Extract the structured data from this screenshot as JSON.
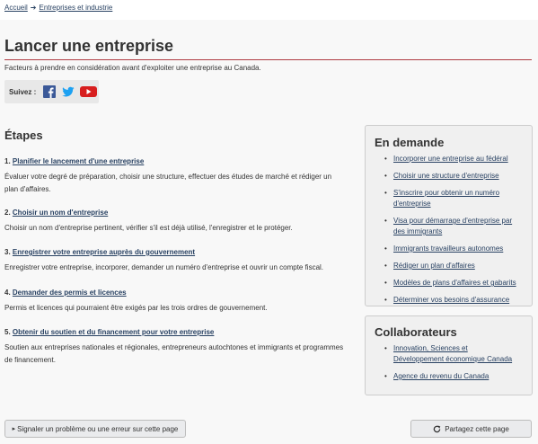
{
  "breadcrumb": {
    "home": "Accueil",
    "arrow": "➔",
    "current": "Entreprises et industrie"
  },
  "page": {
    "title": "Lancer une entreprise",
    "intro": "Facteurs à prendre en considération avant d'exploiter une entreprise au Canada."
  },
  "follow": {
    "label": "Suivez :",
    "icons": [
      "facebook-icon",
      "twitter-icon",
      "youtube-icon"
    ]
  },
  "steps": {
    "heading": "Étapes",
    "items": [
      {
        "num": "1.",
        "link": "Planifier le lancement d'une entreprise",
        "desc": "Évaluer votre degré de préparation, choisir une structure, effectuer des études de marché et rédiger un plan d'affaires."
      },
      {
        "num": "2.",
        "link": "Choisir un nom d'entreprise",
        "desc": "Choisir un nom d'entreprise pertinent, vérifier s'il est déjà utilisé, l'enregistrer et le protéger."
      },
      {
        "num": "3.",
        "link": "Enregistrer votre entreprise auprès du gouvernement",
        "desc": "Enregistrer votre entreprise, incorporer, demander un numéro d'entreprise et ouvrir un compte fiscal."
      },
      {
        "num": "4.",
        "link": "Demander des permis et licences",
        "desc": "Permis et licences qui pourraient être exigés par les trois ordres de gouvernement."
      },
      {
        "num": "5.",
        "link": "Obtenir du soutien et du financement pour votre entreprise",
        "desc": "Soutien aux entreprises nationales et régionales, entrepreneurs autochtones et immigrants et programmes de financement."
      }
    ]
  },
  "demand": {
    "title": "En demande",
    "links": [
      "Incorporer une entreprise au fédéral",
      "Choisir une structure d'entreprise",
      "S'inscrire pour obtenir un numéro d'entreprise",
      "Visa pour démarrage d'entreprise par des immigrants",
      "Immigrants travailleurs autonomes",
      "Rédiger un plan d'affaires",
      "Modèles de plans d'affaires et gabarits",
      "Déterminer vos besoins d'assurance"
    ]
  },
  "partners": {
    "title": "Collaborateurs",
    "links": [
      "Innovation, Sciences et Développement économique Canada",
      "Agence du revenu du Canada"
    ]
  },
  "footer": {
    "report_label": "Signaler un problème ou une erreur sur cette page",
    "report_prefix": "▸",
    "share_label": "Partagez cette page",
    "share_icon": "share-icon"
  },
  "colors": {
    "link": "#284162",
    "rule": "#af3c43",
    "facebook": "#3b5998",
    "twitter": "#1da1f2",
    "youtube": "#d71e1e"
  }
}
